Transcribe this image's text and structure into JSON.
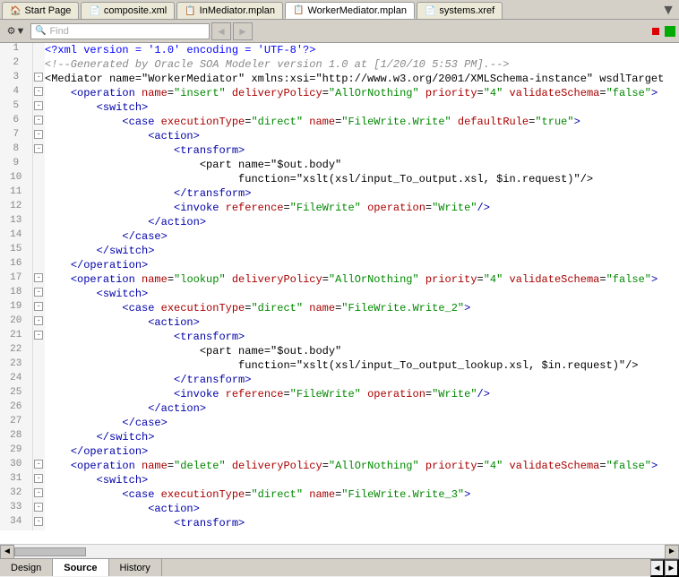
{
  "tabs": [
    {
      "id": "start",
      "label": "Start Page",
      "icon": "🏠",
      "active": false
    },
    {
      "id": "composite",
      "label": "composite.xml",
      "icon": "📄",
      "active": false
    },
    {
      "id": "inmediator",
      "label": "InMediator.mplan",
      "icon": "📋",
      "active": false
    },
    {
      "id": "workermediator",
      "label": "WorkerMediator.mplan",
      "icon": "📋",
      "active": true
    },
    {
      "id": "systems",
      "label": "systems.xref",
      "icon": "📄",
      "active": false
    }
  ],
  "tab_arrow": "▼",
  "toolbar": {
    "search_placeholder": "Find",
    "back_label": "◄",
    "forward_label": "►"
  },
  "code_lines": [
    {
      "num": 1,
      "fold": "",
      "fold_type": "none",
      "text": "<?xml version = '1.0' encoding = 'UTF-8'?>"
    },
    {
      "num": 2,
      "fold": "",
      "fold_type": "none",
      "text": "<!--Generated by Oracle SOA Modeler version 1.0 at [1/20/10 5:53 PM].-->"
    },
    {
      "num": 3,
      "fold": "-",
      "fold_type": "open",
      "text": "<Mediator name=\"WorkerMediator\" xmlns:xsi=\"http://www.w3.org/2001/XMLSchema-instance\" wsdlTarget"
    },
    {
      "num": 4,
      "fold": "-",
      "fold_type": "open",
      "text": "    <operation name=\"insert\" deliveryPolicy=\"AllOrNothing\" priority=\"4\" validateSchema=\"false\">"
    },
    {
      "num": 5,
      "fold": "-",
      "fold_type": "open",
      "text": "        <switch>"
    },
    {
      "num": 6,
      "fold": "-",
      "fold_type": "open",
      "text": "            <case executionType=\"direct\" name=\"FileWrite.Write\" defaultRule=\"true\">"
    },
    {
      "num": 7,
      "fold": "-",
      "fold_type": "open",
      "text": "                <action>"
    },
    {
      "num": 8,
      "fold": "-",
      "fold_type": "open",
      "text": "                    <transform>"
    },
    {
      "num": 9,
      "fold": "",
      "fold_type": "none",
      "text": "                        <part name=\"$out.body\""
    },
    {
      "num": 10,
      "fold": "",
      "fold_type": "none",
      "text": "                              function=\"xslt(xsl/input_To_output.xsl, $in.request)\"/>"
    },
    {
      "num": 11,
      "fold": "",
      "fold_type": "none",
      "text": "                    </transform>"
    },
    {
      "num": 12,
      "fold": "",
      "fold_type": "none",
      "text": "                    <invoke reference=\"FileWrite\" operation=\"Write\"/>"
    },
    {
      "num": 13,
      "fold": "",
      "fold_type": "none",
      "text": "                </action>"
    },
    {
      "num": 14,
      "fold": "",
      "fold_type": "none",
      "text": "            </case>"
    },
    {
      "num": 15,
      "fold": "",
      "fold_type": "none",
      "text": "        </switch>"
    },
    {
      "num": 16,
      "fold": "",
      "fold_type": "none",
      "text": "    </operation>"
    },
    {
      "num": 17,
      "fold": "-",
      "fold_type": "open",
      "text": "    <operation name=\"lookup\" deliveryPolicy=\"AllOrNothing\" priority=\"4\" validateSchema=\"false\">"
    },
    {
      "num": 18,
      "fold": "-",
      "fold_type": "open",
      "text": "        <switch>"
    },
    {
      "num": 19,
      "fold": "-",
      "fold_type": "open",
      "text": "            <case executionType=\"direct\" name=\"FileWrite.Write_2\">"
    },
    {
      "num": 20,
      "fold": "-",
      "fold_type": "open",
      "text": "                <action>"
    },
    {
      "num": 21,
      "fold": "-",
      "fold_type": "open",
      "text": "                    <transform>"
    },
    {
      "num": 22,
      "fold": "",
      "fold_type": "none",
      "text": "                        <part name=\"$out.body\""
    },
    {
      "num": 23,
      "fold": "",
      "fold_type": "none",
      "text": "                              function=\"xslt(xsl/input_To_output_lookup.xsl, $in.request)\"/>"
    },
    {
      "num": 24,
      "fold": "",
      "fold_type": "none",
      "text": "                    </transform>"
    },
    {
      "num": 25,
      "fold": "",
      "fold_type": "none",
      "text": "                    <invoke reference=\"FileWrite\" operation=\"Write\"/>"
    },
    {
      "num": 26,
      "fold": "",
      "fold_type": "none",
      "text": "                </action>"
    },
    {
      "num": 27,
      "fold": "",
      "fold_type": "none",
      "text": "            </case>"
    },
    {
      "num": 28,
      "fold": "",
      "fold_type": "none",
      "text": "        </switch>"
    },
    {
      "num": 29,
      "fold": "",
      "fold_type": "none",
      "text": "    </operation>"
    },
    {
      "num": 30,
      "fold": "-",
      "fold_type": "open",
      "text": "    <operation name=\"delete\" deliveryPolicy=\"AllOrNothing\" priority=\"4\" validateSchema=\"false\">"
    },
    {
      "num": 31,
      "fold": "-",
      "fold_type": "open",
      "text": "        <switch>"
    },
    {
      "num": 32,
      "fold": "-",
      "fold_type": "open",
      "text": "            <case executionType=\"direct\" name=\"FileWrite.Write_3\">"
    },
    {
      "num": 33,
      "fold": "-",
      "fold_type": "open",
      "text": "                <action>"
    },
    {
      "num": 34,
      "fold": "-",
      "fold_type": "open",
      "text": "                    <transform>"
    }
  ],
  "bottom_tabs": [
    {
      "id": "design",
      "label": "Design",
      "active": false
    },
    {
      "id": "source",
      "label": "Source",
      "active": true
    },
    {
      "id": "history",
      "label": "History",
      "active": false
    }
  ],
  "colors": {
    "active_tab_bg": "#ffffff",
    "inactive_tab_bg": "#ece9d8",
    "toolbar_bg": "#d4d0c8",
    "code_bg": "#ffffff",
    "gutter_bg": "#f5f5f5",
    "accent_green": "#00aa00",
    "xml_tag": "#0000aa",
    "xml_comment": "#888888"
  }
}
